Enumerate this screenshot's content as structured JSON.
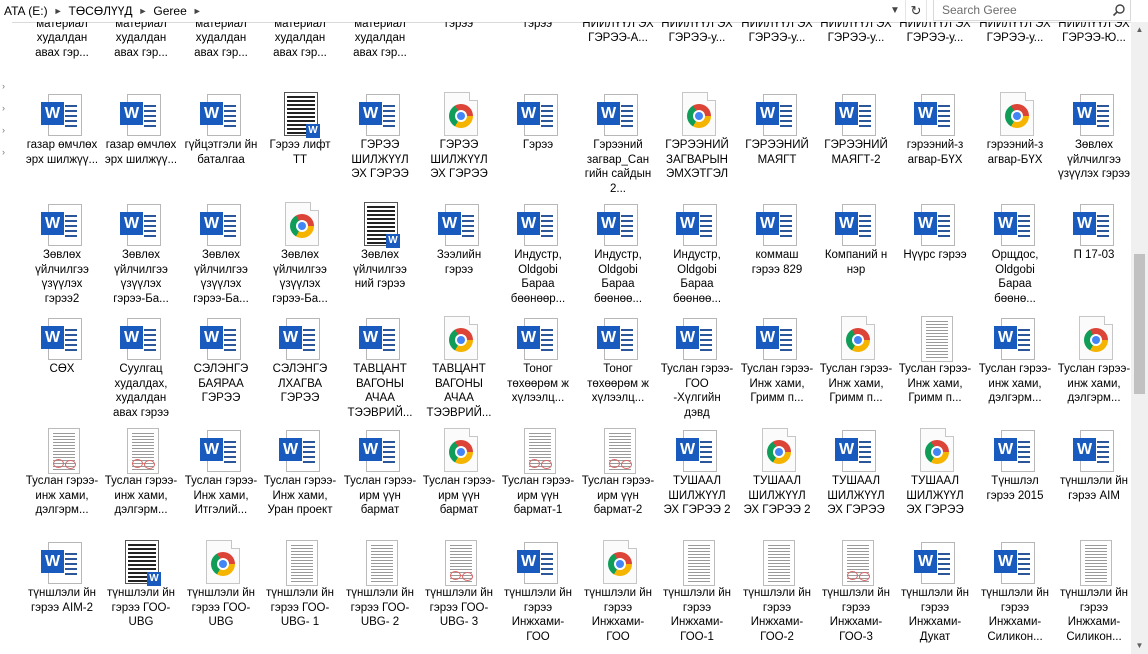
{
  "address_bar": {
    "breadcrumb": [
      "ATA (E:)",
      "ТӨСӨЛҮҮД",
      "Geree"
    ],
    "dropdown_icon": "chevron-down-icon",
    "refresh_icon": "refresh-icon"
  },
  "search": {
    "placeholder": "Search Geree",
    "value": ""
  },
  "files": [
    {
      "label": "бараа материал худалдан авах гэр...",
      "icon": "none"
    },
    {
      "label": "бараа материал худалдан авах гэр...",
      "icon": "none"
    },
    {
      "label": "бараа материал худалдан авах гэр...",
      "icon": "none"
    },
    {
      "label": "бараа материал худалдан авах гэр...",
      "icon": "none"
    },
    {
      "label": "бараа материал худалдан авах гэр...",
      "icon": "none"
    },
    {
      "label": "бэлэглэл ы гэрээ",
      "icon": "none"
    },
    {
      "label": "бэлэглэл ы гэрээ",
      "icon": "none"
    },
    {
      "label": "БЭЛТГЭН НИЙЛҮҮЛ ЭХ ГЭРЭЭ-А...",
      "icon": "none"
    },
    {
      "label": "БЭЛТГЭН НИЙЛҮҮЛ ЭХ ГЭРЭЭ-у...",
      "icon": "none"
    },
    {
      "label": "БЭЛТГЭН НИЙЛҮҮЛ ЭХ ГЭРЭЭ-у...",
      "icon": "none"
    },
    {
      "label": "БЭЛТГЭН НИЙЛҮҮЛ ЭХ ГЭРЭЭ-у...",
      "icon": "none"
    },
    {
      "label": "БЭЛТГЭН НИЙЛҮҮЛ ЭХ ГЭРЭЭ-у...",
      "icon": "none"
    },
    {
      "label": "БЭЛТГЭН НИЙЛҮҮЛ ЭХ ГЭРЭЭ-у...",
      "icon": "none"
    },
    {
      "label": "БЭЛТГЭН НИЙЛҮҮЛ ЭХ ГЭРЭЭ-Ю...",
      "icon": "none"
    },
    {
      "label": "газар өмчлөх эрх шилжүү...",
      "icon": "word"
    },
    {
      "label": "газар өмчлөх эрх шилжүү...",
      "icon": "word"
    },
    {
      "label": "гүйцэтгэли йн баталгаа",
      "icon": "word"
    },
    {
      "label": "Гэрээ лифт ТТ",
      "icon": "dark"
    },
    {
      "label": "ГЭРЭЭ ШИЛЖҮҮЛ ЭХ ГЭРЭЭ",
      "icon": "word"
    },
    {
      "label": "ГЭРЭЭ ШИЛЖҮҮЛ ЭХ ГЭРЭЭ",
      "icon": "chrome"
    },
    {
      "label": "Гэрээ",
      "icon": "word"
    },
    {
      "label": "Гэрээний загвар_Сан гийн сайдын 2...",
      "icon": "word"
    },
    {
      "label": "ГЭРЭЭНИЙ ЗАГВАРЫН ЭМХЭТГЭЛ",
      "icon": "chrome"
    },
    {
      "label": "ГЭРЭЭНИЙ МАЯГТ",
      "icon": "word"
    },
    {
      "label": "ГЭРЭЭНИЙ МАЯГТ-2",
      "icon": "word"
    },
    {
      "label": "гэрээний-з агвар-БҮХ",
      "icon": "word"
    },
    {
      "label": "гэрээний-з агвар-БҮХ",
      "icon": "chrome"
    },
    {
      "label": "Зөвлөх үйлчилгээ үзүүлэх гэрээ",
      "icon": "word"
    },
    {
      "label": "Зөвлөх үйлчилгээ үзүүлэх гэрээ2",
      "icon": "word"
    },
    {
      "label": "Зөвлөх үйлчилгээ үзүүлэх гэрээ-Ба...",
      "icon": "word"
    },
    {
      "label": "Зөвлөх үйлчилгээ үзүүлэх гэрээ-Ба...",
      "icon": "word"
    },
    {
      "label": "Зөвлөх үйлчилгээ үзүүлэх гэрээ-Ба...",
      "icon": "chrome"
    },
    {
      "label": "Зөвлөх үйлчилгээ ний гэрээ",
      "icon": "dark"
    },
    {
      "label": "Зээлийн гэрээ",
      "icon": "word"
    },
    {
      "label": "Индустр, Oldgobi Бараа бөөнөөр...",
      "icon": "word"
    },
    {
      "label": "Индустр, Oldgobi Бараа бөөнөө...",
      "icon": "word"
    },
    {
      "label": "Индустр, Oldgobi Бараа бөөнөө...",
      "icon": "word"
    },
    {
      "label": "коммаш гэрээ 829",
      "icon": "word"
    },
    {
      "label": "Компаний н нэр",
      "icon": "word"
    },
    {
      "label": "Нүүрс гэрээ",
      "icon": "word"
    },
    {
      "label": "Орщдос, Oldgobi Бараа бөөнө...",
      "icon": "word"
    },
    {
      "label": "П 17-03",
      "icon": "word"
    },
    {
      "label": "СӨХ",
      "icon": "word"
    },
    {
      "label": "Суулгац худалдах, худалдан авах гэрээ",
      "icon": "word"
    },
    {
      "label": "СЭЛЭНГЭ БАЯРАА ГЭРЭЭ",
      "icon": "word"
    },
    {
      "label": "СЭЛЭНГЭ ЛХАГВА ГЭРЭЭ",
      "icon": "word"
    },
    {
      "label": "ТАВЦАНТ ВАГОНЫ АЧАА ТЭЭВРИЙ...",
      "icon": "word"
    },
    {
      "label": "ТАВЦАНТ ВАГОНЫ АЧАА ТЭЭВРИЙ...",
      "icon": "chrome"
    },
    {
      "label": "Тоног төхөөрөм ж хүлээлц...",
      "icon": "word"
    },
    {
      "label": "Тоног төхөөрөм ж хүлээлц...",
      "icon": "word"
    },
    {
      "label": "Туслан гэрээ-ГОО -Хүлгийн дэвд",
      "icon": "word"
    },
    {
      "label": "Туслан гэрээ-Инж хами, Гримм п...",
      "icon": "word"
    },
    {
      "label": "Туслан гэрээ-Инж хами, Гримм п...",
      "icon": "chrome"
    },
    {
      "label": "Туслан гэрээ-Инж хами, Гримм п...",
      "icon": "scan"
    },
    {
      "label": "Туслан гэрээ-инж хами, дэлгэрм...",
      "icon": "word"
    },
    {
      "label": "Туслан гэрээ-инж хами, дэлгэрм...",
      "icon": "chrome"
    },
    {
      "label": "Туслан гэрээ-инж хами, дэлгэрм...",
      "icon": "scan-red"
    },
    {
      "label": "Туслан гэрээ-инж хами, дэлгэрм...",
      "icon": "scan-red"
    },
    {
      "label": "Туслан гэрээ-Инж хами, Итгэлий...",
      "icon": "word"
    },
    {
      "label": "Туслан гэрээ-Инж хами, Уран проект",
      "icon": "word"
    },
    {
      "label": "Туслан гэрээ-ирм үүн бармат",
      "icon": "word"
    },
    {
      "label": "Туслан гэрээ-ирм үүн бармат",
      "icon": "chrome"
    },
    {
      "label": "Туслан гэрээ-ирм үүн бармат-1",
      "icon": "scan-red"
    },
    {
      "label": "Туслан гэрээ-ирм үүн бармат-2",
      "icon": "scan-red"
    },
    {
      "label": "ТУШААЛ ШИЛЖҮҮЛ ЭХ ГЭРЭЭ 2",
      "icon": "word"
    },
    {
      "label": "ТУШААЛ ШИЛЖҮҮЛ ЭХ ГЭРЭЭ 2",
      "icon": "chrome"
    },
    {
      "label": "ТУШААЛ ШИЛЖҮҮЛ ЭХ ГЭРЭЭ",
      "icon": "word"
    },
    {
      "label": "ТУШААЛ ШИЛЖҮҮЛ ЭХ ГЭРЭЭ",
      "icon": "chrome"
    },
    {
      "label": "Түншлэл гэрээ 2015",
      "icon": "word"
    },
    {
      "label": "түншлэли йн гэрээ AIM",
      "icon": "word"
    },
    {
      "label": "түншлэли йн гэрээ AIM-2",
      "icon": "word"
    },
    {
      "label": "түншлэли йн гэрээ ГОО-UBG",
      "icon": "dark"
    },
    {
      "label": "түншлэли йн гэрээ ГОО-UBG",
      "icon": "chrome"
    },
    {
      "label": "түншлэли йн гэрээ ГОО-UBG- 1",
      "icon": "scan"
    },
    {
      "label": "түншлэли йн гэрээ ГОО-UBG- 2",
      "icon": "scan"
    },
    {
      "label": "түншлэли йн гэрээ ГОО-UBG- 3",
      "icon": "scan-red"
    },
    {
      "label": "түншлэли йн гэрээ Инжхами- ГОО",
      "icon": "word"
    },
    {
      "label": "түншлэли йн гэрээ Инжхами- ГОО",
      "icon": "chrome"
    },
    {
      "label": "түншлэли йн гэрээ Инжхами- ГОО-1",
      "icon": "scan"
    },
    {
      "label": "түншлэли йн гэрээ Инжхами- ГОО-2",
      "icon": "scan"
    },
    {
      "label": "түншлэли йн гэрээ Инжхами- ГОО-3",
      "icon": "scan-red"
    },
    {
      "label": "түншлэли йн гэрээ Инжхами- Дукат",
      "icon": "word"
    },
    {
      "label": "түншлэли йн гэрээ Инжхами- Силикон...",
      "icon": "word"
    },
    {
      "label": "түншлэли йн гэрээ Инжхами- Силикон...",
      "icon": "scan"
    }
  ]
}
